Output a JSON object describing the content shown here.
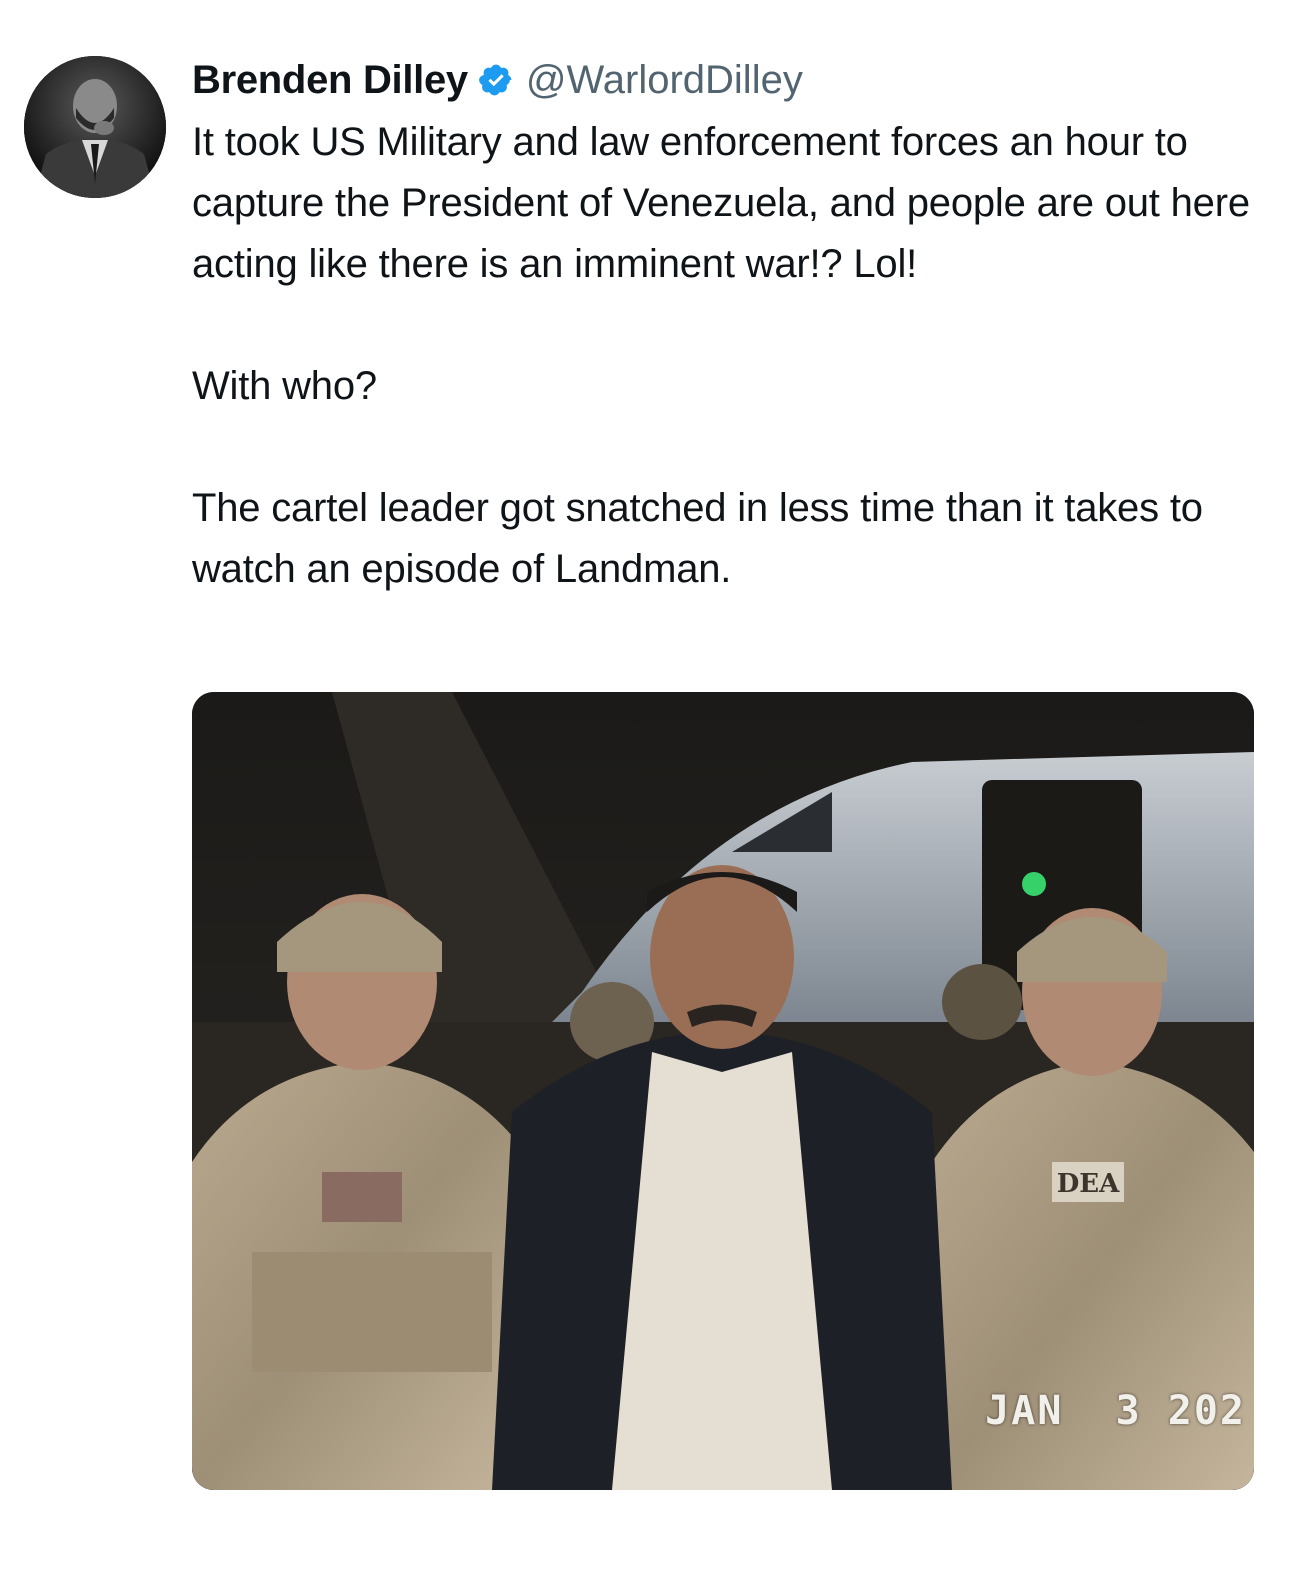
{
  "author": {
    "display_name": "Brenden Dilley",
    "handle": "@WarlordDilley",
    "verified": true,
    "avatar_icon": "profile-photo",
    "verified_color": "#1d9bf0"
  },
  "tweet": {
    "paragraphs": [
      "It took US Military and law enforcement forces an hour to capture the President of Venezuela, and people are out here acting like there is an imminent war!? Lol!",
      "With who?",
      "The cartel leader got snatched in less time than it takes to watch an episode of Landman."
    ]
  },
  "media": {
    "date_stamp": "JAN  3 202",
    "patch_text": "DEA"
  },
  "colors": {
    "text": "#0f1419",
    "secondary_text": "#536471",
    "background": "#ffffff"
  }
}
